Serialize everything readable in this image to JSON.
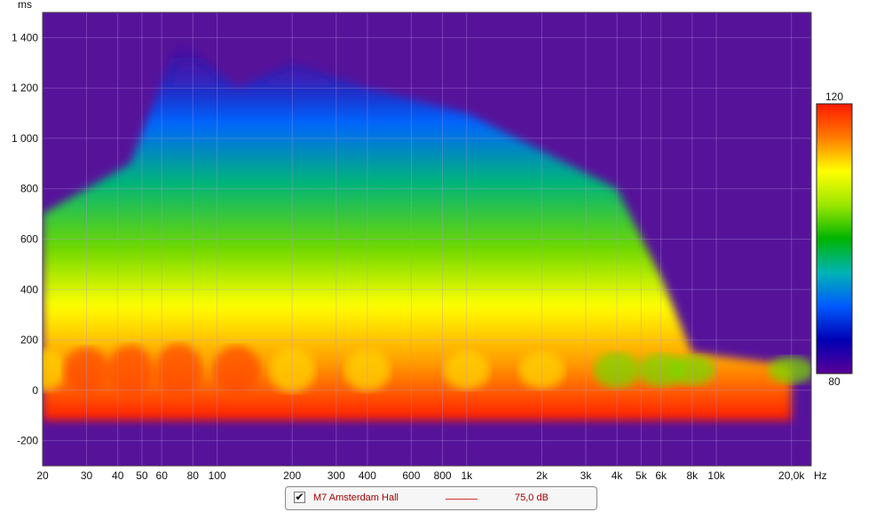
{
  "chart_data": {
    "type": "heatmap",
    "subtype": "spectrogram",
    "series": [
      {
        "name": "M7 Amsterdam Hall",
        "level": "75,0 dB"
      }
    ],
    "x_axis": {
      "scale": "log",
      "range": [
        20,
        24000
      ],
      "unit": "Hz",
      "ticks": [
        20,
        30,
        40,
        50,
        60,
        80,
        100,
        200,
        300,
        400,
        600,
        800,
        1000,
        2000,
        3000,
        4000,
        5000,
        6000,
        8000,
        10000,
        20000
      ],
      "tick_labels": [
        "20",
        "30",
        "40",
        "50",
        "60",
        "80",
        "100",
        "200",
        "300",
        "400",
        "600",
        "800",
        "1k",
        "2k",
        "3k",
        "4k",
        "5k",
        "6k",
        "8k",
        "10k",
        "20,0k"
      ]
    },
    "y_axis": {
      "unit": "ms",
      "range": [
        -300,
        1500
      ],
      "ticks": [
        -200,
        0,
        200,
        400,
        600,
        800,
        1000,
        1200,
        1400
      ],
      "tick_labels": [
        "-200",
        "0",
        "200",
        "400",
        "600",
        "800",
        "1 000",
        "1 200",
        "1 400"
      ]
    },
    "colorbar": {
      "range": [
        80,
        120
      ],
      "labels": [
        "120",
        "80"
      ],
      "colors": [
        "#ff1a00",
        "#ff7a00",
        "#ffff00",
        "#9be600",
        "#00b400",
        "#00b4b4",
        "#005aff",
        "#0000b4",
        "#5a0096"
      ]
    },
    "background_color": "#56139a",
    "grid": true,
    "decay_profile": [
      {
        "freq": 20,
        "time": 700,
        "level": 112
      },
      {
        "freq": 30,
        "time": 800,
        "level": 115
      },
      {
        "freq": 45,
        "time": 900,
        "level": 118
      },
      {
        "freq": 70,
        "time": 1400,
        "level": 120
      },
      {
        "freq": 120,
        "time": 1200,
        "level": 117
      },
      {
        "freq": 200,
        "time": 1300,
        "level": 114
      },
      {
        "freq": 400,
        "time": 1200,
        "level": 112
      },
      {
        "freq": 1000,
        "time": 1100,
        "level": 110
      },
      {
        "freq": 2000,
        "time": 950,
        "level": 109
      },
      {
        "freq": 4000,
        "time": 800,
        "level": 108
      },
      {
        "freq": 6000,
        "time": 450,
        "level": 106
      },
      {
        "freq": 8000,
        "time": 150,
        "level": 104
      },
      {
        "freq": 20000,
        "time": 100,
        "level": 102
      }
    ]
  }
}
